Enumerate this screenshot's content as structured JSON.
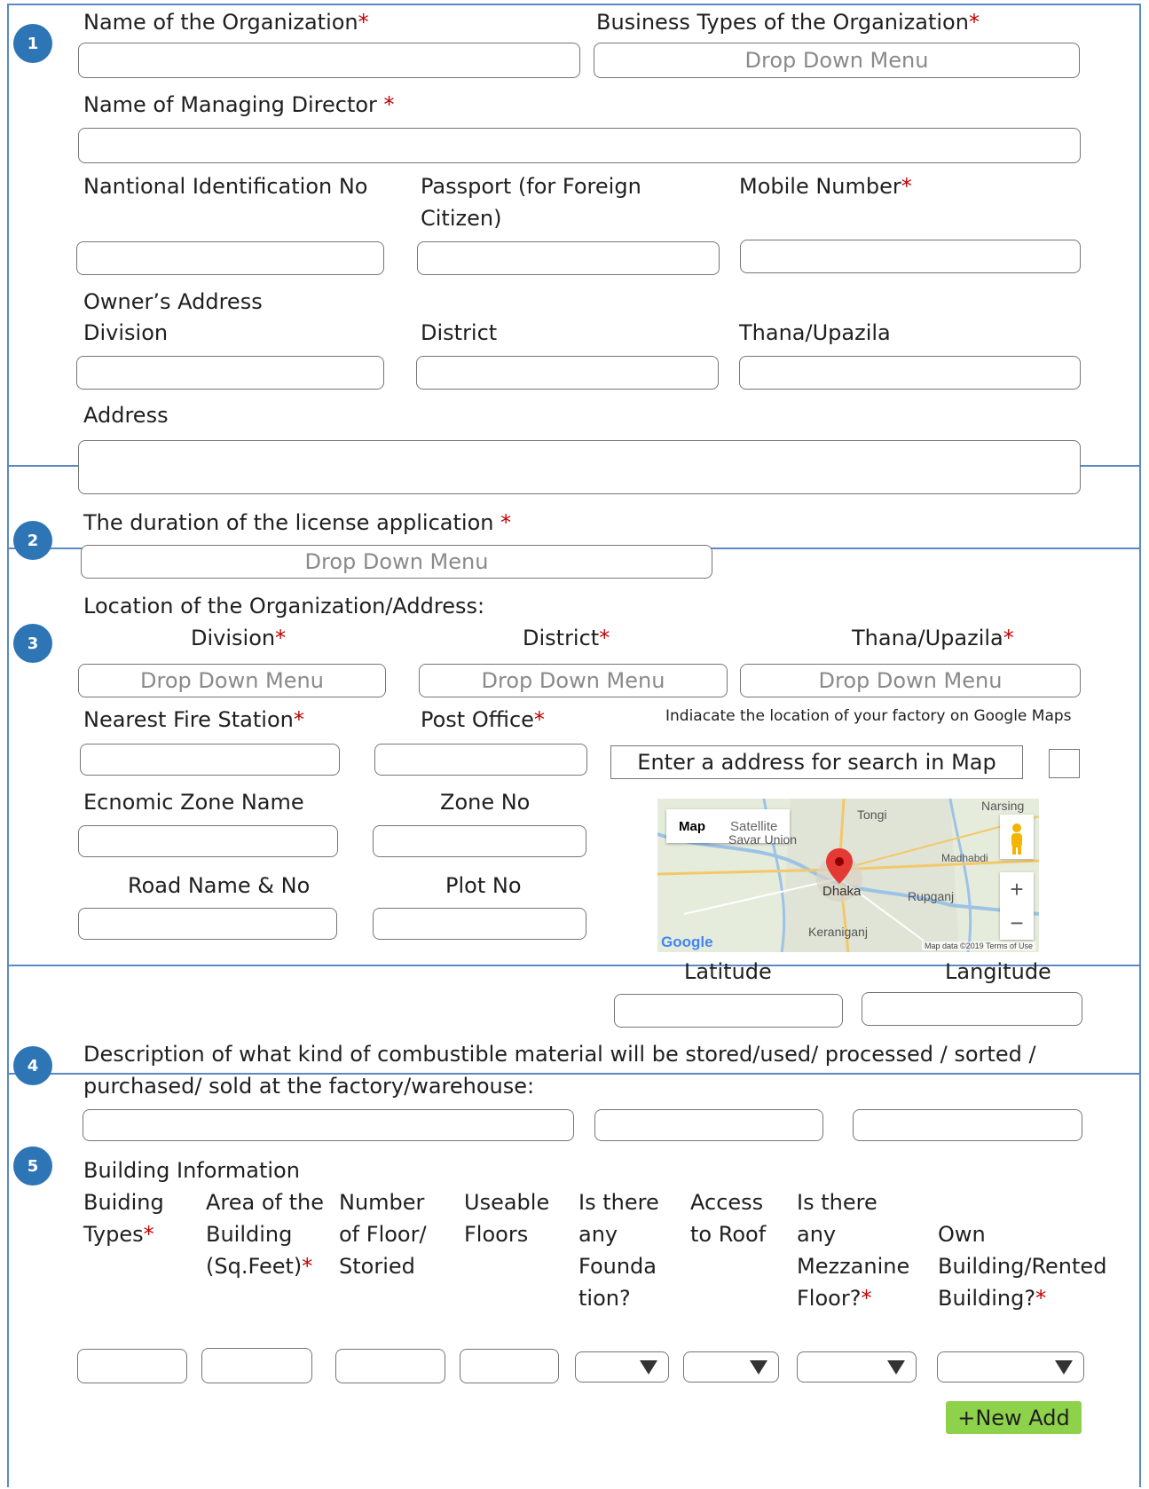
{
  "common": {
    "required_mark": "*",
    "dropdown_placeholder": "Drop Down Menu"
  },
  "section1": {
    "number": "1",
    "org_name_label": "Name of the Organization",
    "business_types_label": "Business Types of the Organization",
    "managing_director_label": "Name of Managing Director ",
    "nid_label": "Nantional Identification No",
    "passport_label": "Passport (for Foreign Citizen)",
    "mobile_label": "Mobile Number",
    "owner_address_label": "Owner’s Address",
    "division_label": "Division",
    "district_label": "District",
    "thana_label": "Thana/Upazila",
    "address_label": "Address"
  },
  "section2": {
    "number": "2",
    "duration_label": "The duration of the license application "
  },
  "section3": {
    "number": "3",
    "location_label": "Location of the Organization/Address:",
    "division_label": "Division",
    "district_label": "District",
    "thana_label": "Thana/Upazila",
    "fire_station_label": "Nearest Fire Station",
    "post_office_label": "Post Office",
    "map_hint": "Indiacate the location of your factory on Google Maps",
    "map_search_text": "Enter a address for search in Map",
    "economic_zone_label": "Ecnomic Zone Name",
    "zone_no_label": "Zone No",
    "road_label": "Road Name & No",
    "plot_label": "Plot No",
    "latitude_label": "Latitude",
    "longitude_label": "Langitude",
    "map": {
      "map_tab": "Map",
      "satellite_tab": "Satellite",
      "place_tongi": "Tongi",
      "place_savar": "Savar Union",
      "place_dhaka": "Dhaka",
      "place_rupganj": "Rupganj",
      "place_madhabdi": "Madhabdi",
      "place_keraniganj": "Keraniganj",
      "place_narsing": "Narsing",
      "google_logo": "Google",
      "footer": "Map data ©2019   Terms of Use",
      "zoom_in": "+",
      "zoom_out": "−"
    }
  },
  "section4": {
    "number": "4",
    "description_label": "Description of what kind of combustible material will be stored/used/ processed / sorted / purchased/ sold at the factory/warehouse:"
  },
  "section5": {
    "number": "5",
    "building_info_label": "Building Information",
    "col_building_types": "Buiding Types",
    "col_area": "Area of the Building (Sq.Feet)",
    "col_floors": "Number of Floor/ Storied",
    "col_useable": "Useable Floors",
    "col_foundation": "Is there any Founda tion?",
    "col_roof": "Access to Roof",
    "col_mezzanine": "Is there any Mezzanine Floor?",
    "col_own_rented": "Own Building/Rented Building?",
    "new_add_button": "+New Add"
  }
}
